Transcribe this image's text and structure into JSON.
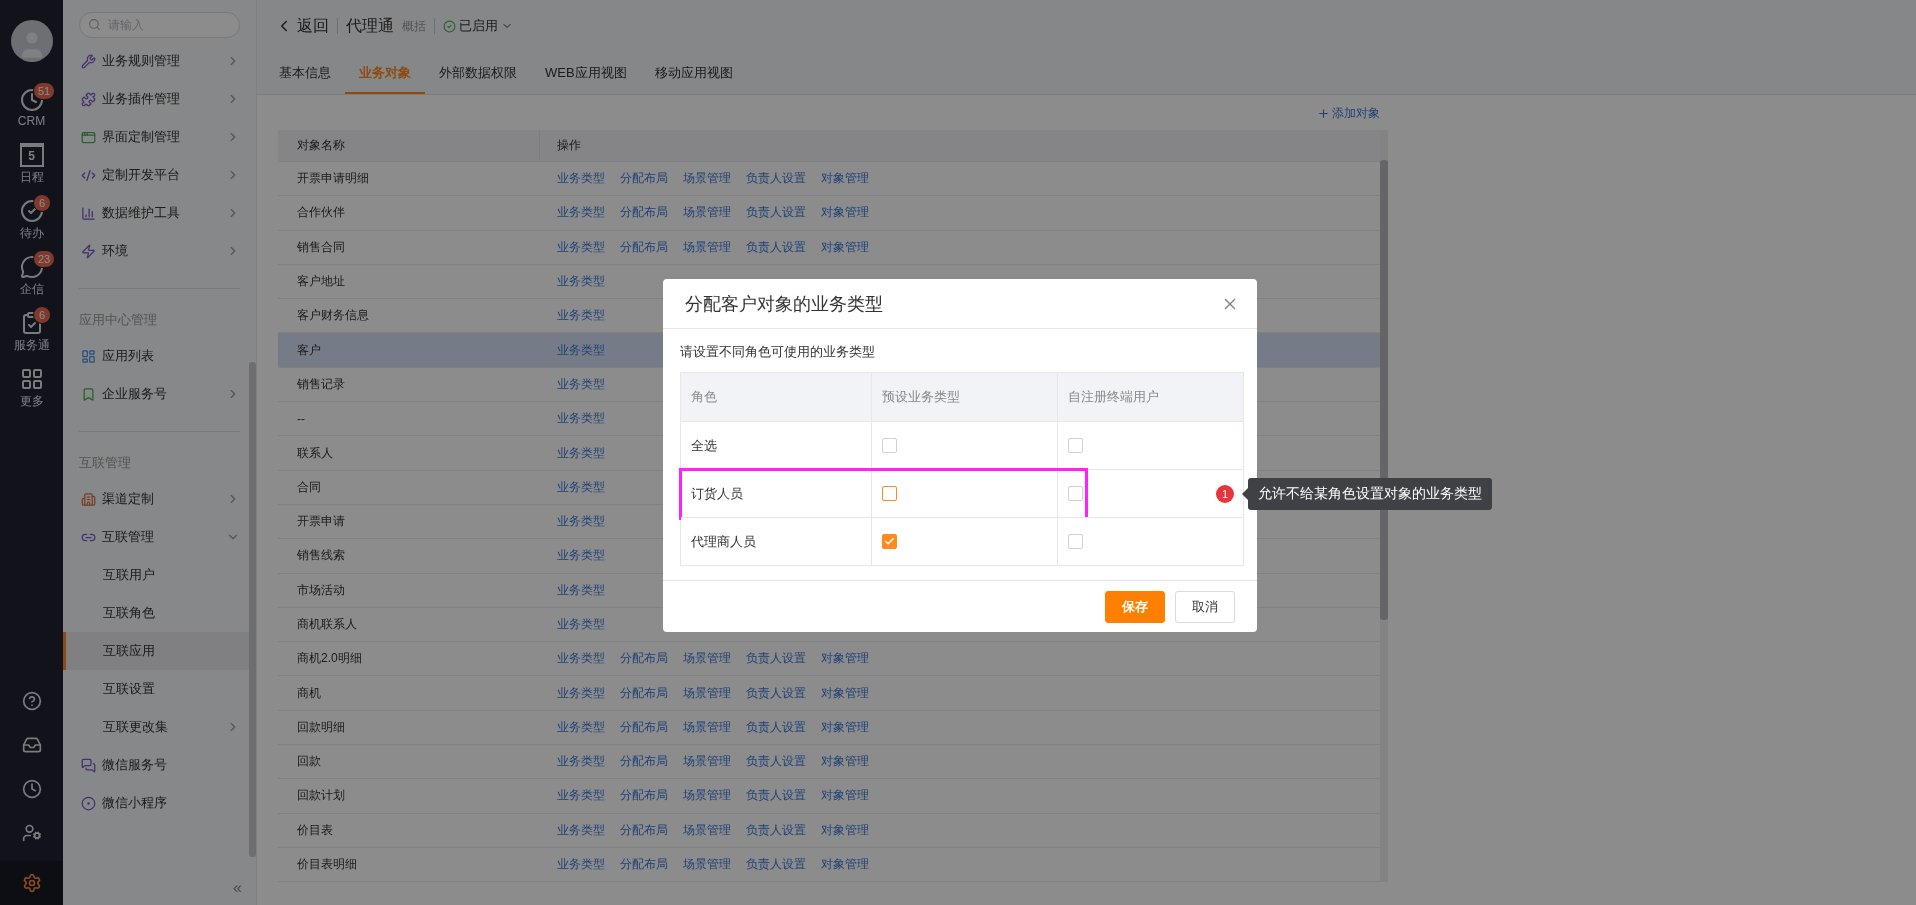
{
  "nav": {
    "items": [
      {
        "label": "CRM",
        "badge": "51"
      },
      {
        "label": "日程",
        "day": "5"
      },
      {
        "label": "待办",
        "badge": "6"
      },
      {
        "label": "企信",
        "badge": "23"
      },
      {
        "label": "服务通",
        "badge": "6"
      },
      {
        "label": "更多"
      }
    ],
    "tools": [
      {
        "selected": false
      },
      {
        "selected": false
      },
      {
        "selected": false
      },
      {
        "selected": false
      },
      {
        "selected": true
      }
    ]
  },
  "sidebar": {
    "search": {
      "placeholder": "请输入"
    },
    "groups": [
      {
        "items": [
          {
            "label": "业务规则管理",
            "expandable": true,
            "expanded": false,
            "selected": false
          },
          {
            "label": "业务插件管理",
            "expandable": true,
            "expanded": false,
            "selected": false
          },
          {
            "label": "界面定制管理",
            "expandable": true,
            "expanded": false,
            "selected": false
          },
          {
            "label": "定制开发平台",
            "expandable": true,
            "expanded": false,
            "selected": false
          },
          {
            "label": "数据维护工具",
            "expandable": true,
            "expanded": false,
            "selected": false
          },
          {
            "label": "环境",
            "expandable": true,
            "expanded": false,
            "selected": false
          }
        ]
      },
      {
        "title": "应用中心管理",
        "items": [
          {
            "label": "应用列表",
            "expandable": false,
            "selected": false
          },
          {
            "label": "企业服务号",
            "expandable": true,
            "expanded": false,
            "selected": false
          }
        ]
      },
      {
        "title": "互联管理",
        "items": [
          {
            "label": "渠道定制",
            "expandable": true,
            "expanded": false,
            "selected": false
          },
          {
            "label": "互联管理",
            "expandable": true,
            "expanded": true,
            "selected": false,
            "children": [
              {
                "label": "互联用户",
                "expandable": false,
                "selected": false
              },
              {
                "label": "互联角色",
                "expandable": false,
                "selected": false
              },
              {
                "label": "互联应用",
                "expandable": false,
                "selected": true
              },
              {
                "label": "互联设置",
                "expandable": false,
                "selected": false
              },
              {
                "label": "互联更改集",
                "expandable": true,
                "expanded": false,
                "selected": false
              }
            ]
          },
          {
            "label": "微信服务号",
            "expandable": false,
            "selected": false
          },
          {
            "label": "微信小程序",
            "expandable": false,
            "selected": false
          }
        ]
      }
    ],
    "collapse": "«"
  },
  "header": {
    "back": "返回",
    "title": "代理通",
    "subtitle": "概括",
    "status": "已启用"
  },
  "tabs": [
    {
      "label": "基本信息",
      "selected": false
    },
    {
      "label": "业务对象",
      "selected": true
    },
    {
      "label": "外部数据权限",
      "selected": false
    },
    {
      "label": "WEB应用视图",
      "selected": false
    },
    {
      "label": "移动应用视图",
      "selected": false
    }
  ],
  "add_button": "添加对象",
  "table": {
    "columns": [
      "对象名称",
      "操作"
    ],
    "rows": [
      {
        "name": "开票申请明细",
        "selected": false,
        "actions": [
          "业务类型",
          "分配布局",
          "场景管理",
          "负责人设置",
          "对象管理"
        ]
      },
      {
        "name": "合作伙伴",
        "selected": false,
        "actions": [
          "业务类型",
          "分配布局",
          "场景管理",
          "负责人设置",
          "对象管理"
        ]
      },
      {
        "name": "销售合同",
        "selected": false,
        "actions": [
          "业务类型",
          "分配布局",
          "场景管理",
          "负责人设置",
          "对象管理"
        ]
      },
      {
        "name": "客户地址",
        "selected": false,
        "actions": [
          "业务类型"
        ]
      },
      {
        "name": "客户财务信息",
        "selected": false,
        "actions": [
          "业务类型"
        ]
      },
      {
        "name": "客户",
        "selected": true,
        "actions": [
          "业务类型"
        ]
      },
      {
        "name": "销售记录",
        "selected": false,
        "actions": [
          "业务类型"
        ]
      },
      {
        "name": "--",
        "selected": false,
        "actions": [
          "业务类型"
        ]
      },
      {
        "name": "联系人",
        "selected": false,
        "actions": [
          "业务类型"
        ]
      },
      {
        "name": "合同",
        "selected": false,
        "actions": [
          "业务类型"
        ]
      },
      {
        "name": "开票申请",
        "selected": false,
        "actions": [
          "业务类型"
        ]
      },
      {
        "name": "销售线索",
        "selected": false,
        "actions": [
          "业务类型"
        ]
      },
      {
        "name": "市场活动",
        "selected": false,
        "actions": [
          "业务类型"
        ]
      },
      {
        "name": "商机联系人",
        "selected": false,
        "actions": [
          "业务类型"
        ]
      },
      {
        "name": "商机2.0明细",
        "selected": false,
        "actions": [
          "业务类型",
          "分配布局",
          "场景管理",
          "负责人设置",
          "对象管理"
        ]
      },
      {
        "name": "商机",
        "selected": false,
        "actions": [
          "业务类型",
          "分配布局",
          "场景管理",
          "负责人设置",
          "对象管理"
        ]
      },
      {
        "name": "回款明细",
        "selected": false,
        "actions": [
          "业务类型",
          "分配布局",
          "场景管理",
          "负责人设置",
          "对象管理"
        ]
      },
      {
        "name": "回款",
        "selected": false,
        "actions": [
          "业务类型",
          "分配布局",
          "场景管理",
          "负责人设置",
          "对象管理"
        ]
      },
      {
        "name": "回款计划",
        "selected": false,
        "actions": [
          "业务类型",
          "分配布局",
          "场景管理",
          "负责人设置",
          "对象管理"
        ]
      },
      {
        "name": "价目表",
        "selected": false,
        "actions": [
          "业务类型",
          "分配布局",
          "场景管理",
          "负责人设置",
          "对象管理"
        ]
      },
      {
        "name": "价目表明细",
        "selected": false,
        "actions": [
          "业务类型",
          "分配布局",
          "场景管理",
          "负责人设置",
          "对象管理"
        ]
      }
    ]
  },
  "dialog": {
    "title": "分配客户对象的业务类型",
    "hint": "请设置不同角色可使用的业务类型",
    "columns": [
      "角色",
      "预设业务类型",
      "自注册终端用户"
    ],
    "rows": [
      {
        "role": "全选",
        "highlighted": false,
        "preset": {
          "checked": false
        },
        "self_registered": {
          "checked": false
        }
      },
      {
        "role": "订货人员",
        "highlighted": true,
        "preset": {
          "checked": false
        },
        "self_registered": {
          "checked": false
        }
      },
      {
        "role": "代理商人员",
        "highlighted": false,
        "preset": {
          "checked": true
        },
        "self_registered": {
          "checked": false
        }
      }
    ],
    "buttons": [
      {
        "label": "保存",
        "kind": "primary"
      },
      {
        "label": "取消",
        "kind": "secondary"
      }
    ]
  },
  "annotation": {
    "number": "1",
    "text": "允许不给某角色设置对象的业务类型"
  }
}
